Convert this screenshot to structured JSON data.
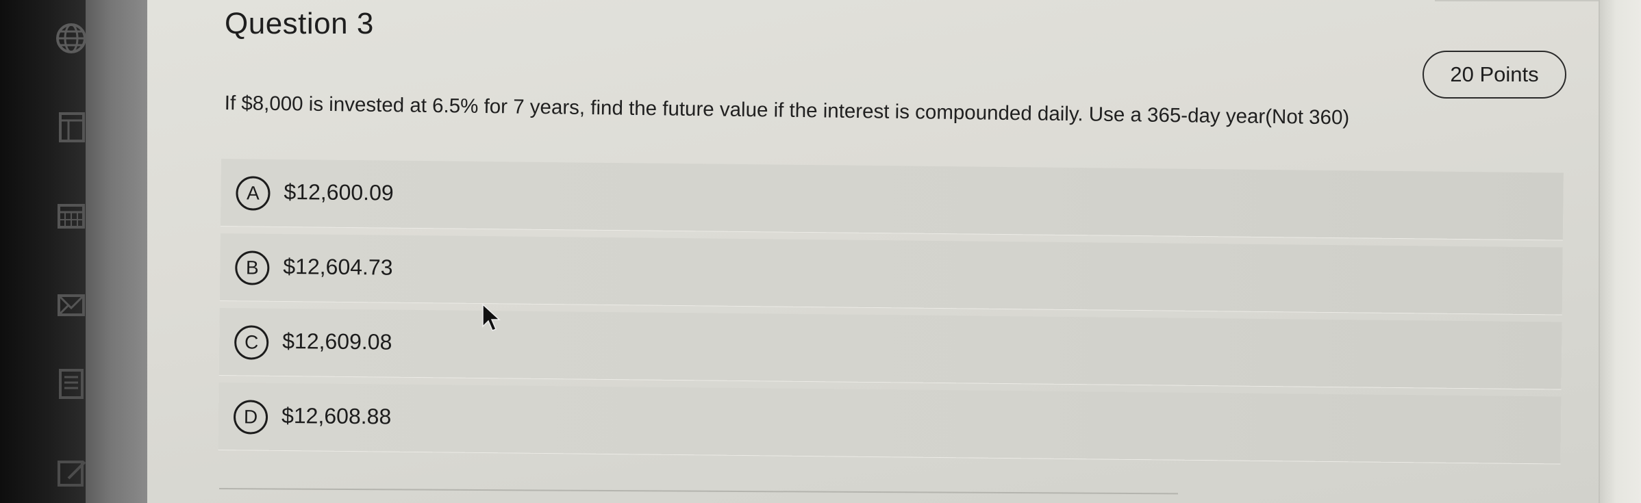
{
  "question": {
    "title": "Question 3",
    "points": "20 Points",
    "text": "If $8,000 is invested at 6.5% for 7 years, find the future value if the interest is compounded daily. Use a 365-day year(Not 360)"
  },
  "options": [
    {
      "letter": "A",
      "value": "$12,600.09"
    },
    {
      "letter": "B",
      "value": "$12,604.73"
    },
    {
      "letter": "C",
      "value": "$12,609.08"
    },
    {
      "letter": "D",
      "value": "$12,608.88"
    }
  ],
  "rail_icons": [
    "globe-icon",
    "document-icon",
    "calendar-icon",
    "mail-icon",
    "list-icon",
    "edit-icon"
  ],
  "colors": {
    "page_bg": "#dddcd6",
    "text": "#1e1e1e",
    "option_bg": "#d3d3cd"
  }
}
